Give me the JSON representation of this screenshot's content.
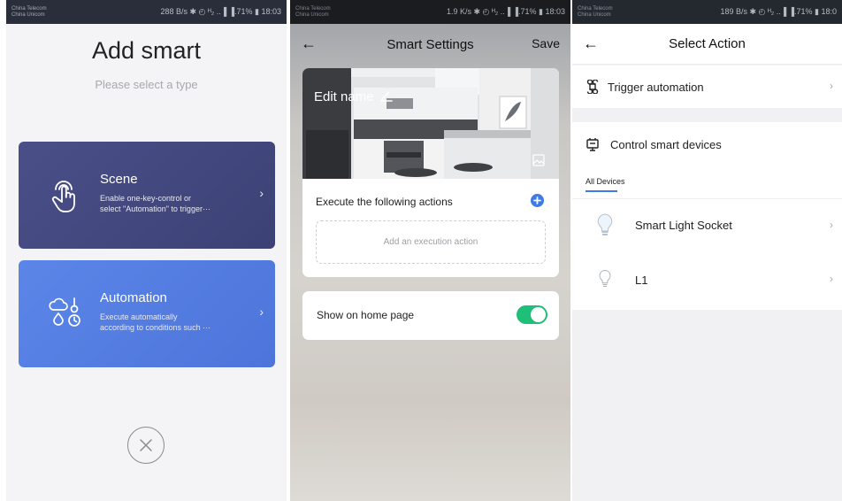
{
  "status_bars": [
    {
      "carriers": [
        "China Telecom",
        "China Unicom"
      ],
      "system": "288 B/s ✱ ◴ ᴴ₂ ..▐ ▐.71% ▮ 18:03"
    },
    {
      "carriers": [
        "China Telecom",
        "China Unicom"
      ],
      "system": "1.9 K/s ✱ ◴ ᴴ₂ ..▐ ▐.71% ▮ 18:03"
    },
    {
      "carriers": [
        "China Telecom",
        "China Unicom"
      ],
      "system": "189 B/s ✱ ◴ ᴴ₂ ..▐ ▐.71% ▮ 18:0"
    }
  ],
  "add_smart": {
    "title": "Add smart",
    "subtitle": "Please select a type",
    "types": [
      {
        "name": "Scene",
        "desc_line1": "Enable one-key-control or",
        "desc_line2": "select \"Automation\" to trigger···",
        "color_top": "#4a4f88",
        "color_bottom": "#3c4175",
        "icon": "touch-hand-icon"
      },
      {
        "name": "Automation",
        "desc_line1": "Execute automatically",
        "desc_line2": "according to conditions such ···",
        "color_top": "#5b86e8",
        "color_bottom": "#4d74da",
        "icon": "weather-conditions-icon"
      }
    ]
  },
  "smart_settings": {
    "title": "Smart Settings",
    "save_label": "Save",
    "edit_name": "Edit name",
    "execute_label": "Execute the following actions",
    "add_action_label": "Add an execution action",
    "show_home_label": "Show on home page",
    "show_home_enabled": true,
    "accent_color": "#3d7be8",
    "toggle_color": "#1ebf79"
  },
  "select_action": {
    "title": "Select Action",
    "trigger_label": "Trigger automation",
    "control_label": "Control smart devices",
    "tab_label": "All Devices",
    "devices": [
      {
        "name": "Smart Light Socket",
        "icon": "bulb-icon"
      },
      {
        "name": "L1",
        "icon": "bulb-outline-icon"
      }
    ]
  }
}
